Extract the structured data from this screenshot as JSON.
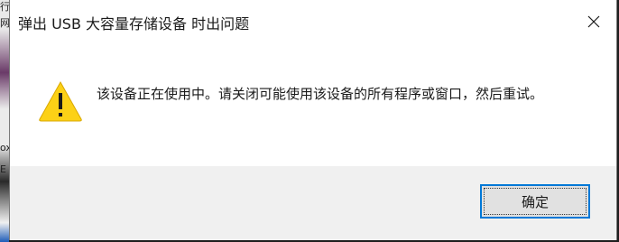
{
  "dialog": {
    "title": "弹出 USB 大容量存储设备 时出问题",
    "message": "该设备正在使用中。请关闭可能使用该设备的所有程序或窗口，然后重试。",
    "ok_label": "确定",
    "icons": {
      "close": "close-icon",
      "warning": "warning-icon"
    }
  },
  "background": {
    "glyphs": [
      "行",
      "网",
      "ox",
      "E"
    ]
  },
  "colors": {
    "accent": "#0078d7",
    "warning_fill": "#fcd116",
    "footer_bg": "#f0f0f0"
  }
}
